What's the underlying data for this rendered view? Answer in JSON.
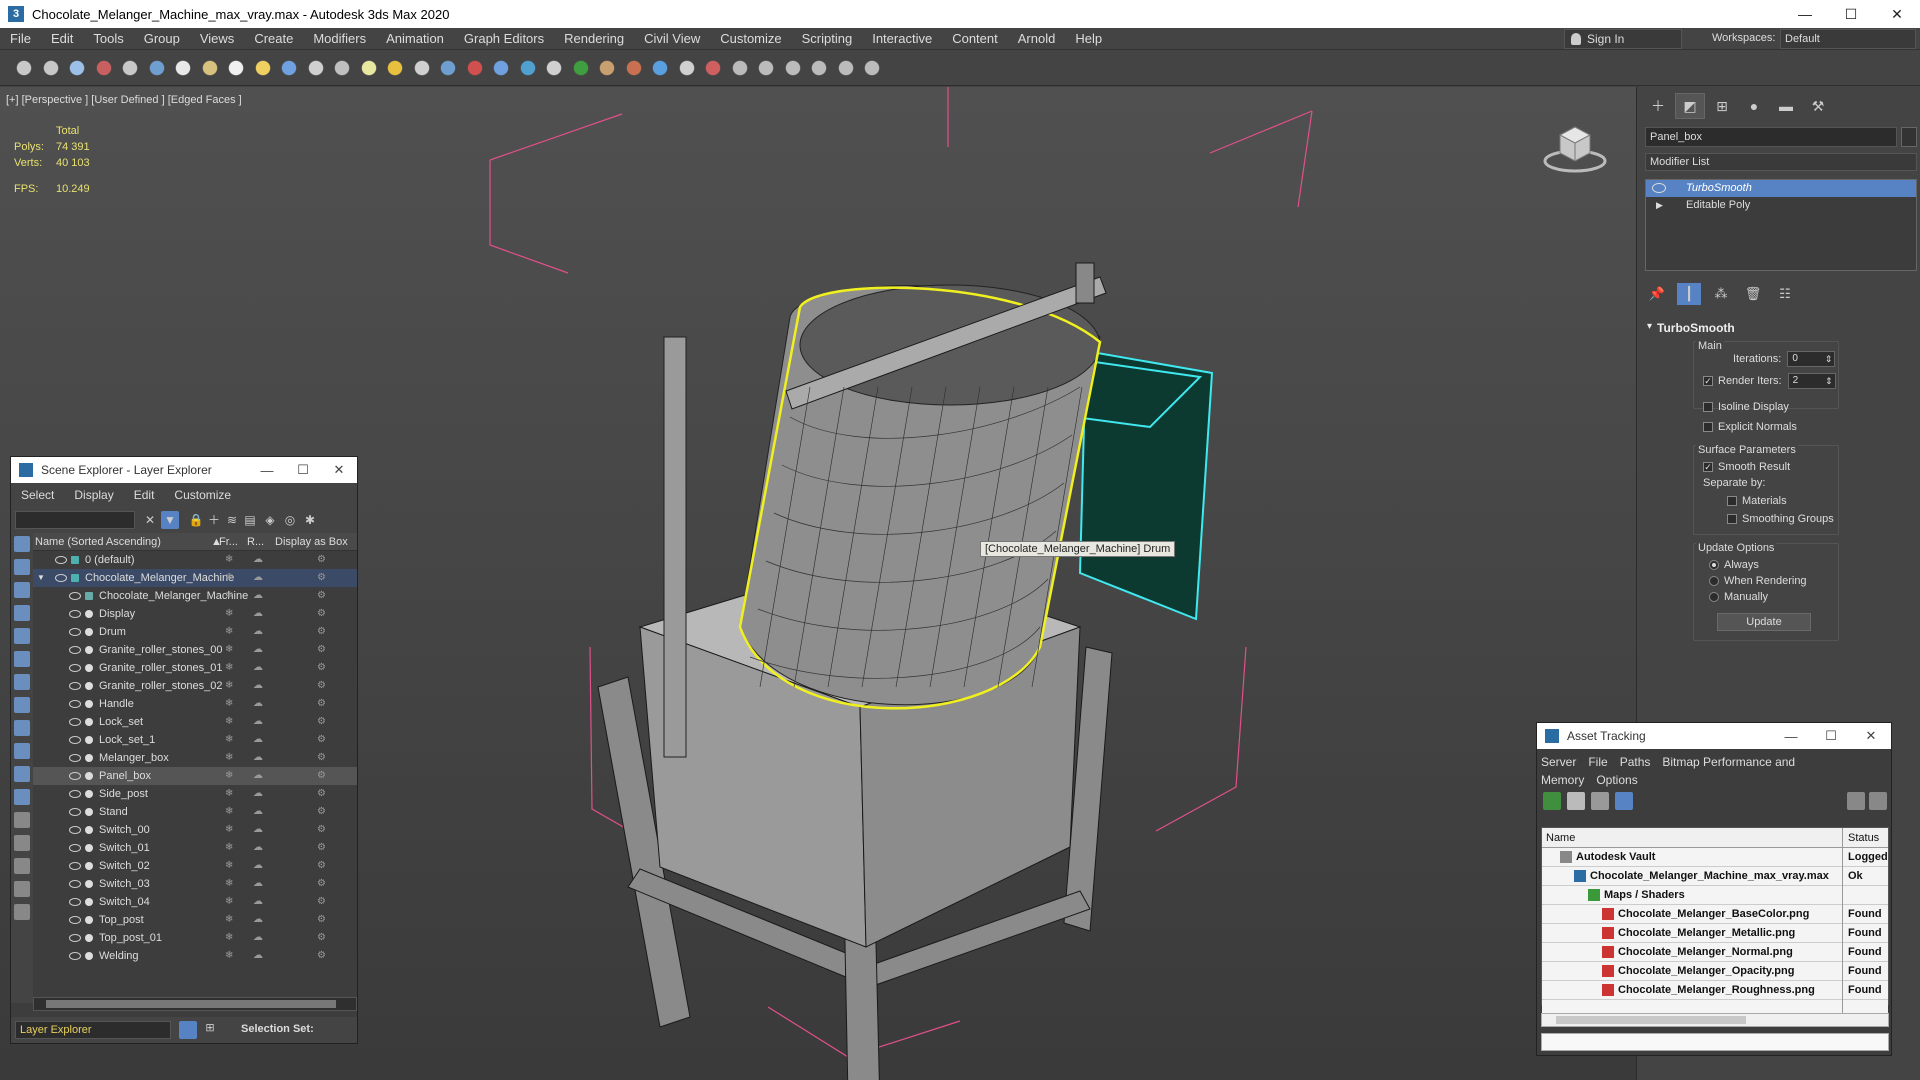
{
  "window": {
    "title": "Chocolate_Melanger_Machine_max_vray.max - Autodesk 3ds Max 2020",
    "minimize": "—",
    "maximize": "☐",
    "close": "✕"
  },
  "menubar": {
    "items": [
      "File",
      "Edit",
      "Tools",
      "Group",
      "Views",
      "Create",
      "Modifiers",
      "Animation",
      "Graph Editors",
      "Rendering",
      "Civil View",
      "Customize",
      "Scripting",
      "Interactive",
      "Content",
      "Arnold",
      "Help"
    ],
    "sign_in": "Sign In",
    "workspaces_label": "Workspaces:",
    "workspace_value": "Default"
  },
  "viewport": {
    "label": "[+] [Perspective ] [User Defined ] [Edged Faces ]",
    "stats": {
      "total_label": "Total",
      "polys_label": "Polys:",
      "polys_value": "74 391",
      "verts_label": "Verts:",
      "verts_value": "40 103",
      "fps_label": "FPS:",
      "fps_value": "10.249"
    },
    "tooltip": "[Chocolate_Melanger_Machine] Drum"
  },
  "command_panel": {
    "object_name": "Panel_box",
    "modifier_list": "Modifier List",
    "stack": [
      {
        "label": "TurboSmooth",
        "selected": true
      },
      {
        "label": "Editable Poly",
        "selected": false
      }
    ],
    "rollout_title": "TurboSmooth",
    "main_label": "Main",
    "iterations_label": "Iterations:",
    "iterations_value": "0",
    "render_iters_label": "Render Iters:",
    "render_iters_value": "2",
    "isoline_label": "Isoline Display",
    "explicit_normals_label": "Explicit Normals",
    "surface_params_label": "Surface Parameters",
    "smooth_result_label": "Smooth Result",
    "separate_by_label": "Separate by:",
    "materials_label": "Materials",
    "smoothing_groups_label": "Smoothing Groups",
    "update_options_label": "Update Options",
    "always_label": "Always",
    "when_rendering_label": "When Rendering",
    "manually_label": "Manually",
    "update_button": "Update"
  },
  "scene_explorer": {
    "title": "Scene Explorer - Layer Explorer",
    "menu": [
      "Select",
      "Display",
      "Edit",
      "Customize"
    ],
    "columns": {
      "name": "Name (Sorted Ascending)",
      "frozen": "Fr...",
      "renderable": "R...",
      "display_as_box": "Display as Box"
    },
    "rows": [
      {
        "name": "0 (default)",
        "level": 0,
        "kind": "layer"
      },
      {
        "name": "Chocolate_Melanger_Machine",
        "level": 0,
        "kind": "layer-open",
        "selected": true
      },
      {
        "name": "Chocolate_Melanger_Machine",
        "level": 1,
        "kind": "group"
      },
      {
        "name": "Display",
        "level": 1,
        "kind": "obj"
      },
      {
        "name": "Drum",
        "level": 1,
        "kind": "obj"
      },
      {
        "name": "Granite_roller_stones_00",
        "level": 1,
        "kind": "obj"
      },
      {
        "name": "Granite_roller_stones_01",
        "level": 1,
        "kind": "obj"
      },
      {
        "name": "Granite_roller_stones_02",
        "level": 1,
        "kind": "obj"
      },
      {
        "name": "Handle",
        "level": 1,
        "kind": "obj"
      },
      {
        "name": "Lock_set",
        "level": 1,
        "kind": "obj"
      },
      {
        "name": "Lock_set_1",
        "level": 1,
        "kind": "obj"
      },
      {
        "name": "Melanger_box",
        "level": 1,
        "kind": "obj"
      },
      {
        "name": "Panel_box",
        "level": 1,
        "kind": "obj",
        "highlight": true
      },
      {
        "name": "Side_post",
        "level": 1,
        "kind": "obj"
      },
      {
        "name": "Stand",
        "level": 1,
        "kind": "obj"
      },
      {
        "name": "Switch_00",
        "level": 1,
        "kind": "obj"
      },
      {
        "name": "Switch_01",
        "level": 1,
        "kind": "obj"
      },
      {
        "name": "Switch_02",
        "level": 1,
        "kind": "obj"
      },
      {
        "name": "Switch_03",
        "level": 1,
        "kind": "obj"
      },
      {
        "name": "Switch_04",
        "level": 1,
        "kind": "obj"
      },
      {
        "name": "Top_post",
        "level": 1,
        "kind": "obj"
      },
      {
        "name": "Top_post_01",
        "level": 1,
        "kind": "obj"
      },
      {
        "name": "Welding",
        "level": 1,
        "kind": "obj"
      }
    ],
    "footer_layer": "Layer Explorer",
    "selection_set_label": "Selection Set:"
  },
  "asset_tracking": {
    "title": "Asset Tracking",
    "menu": [
      "Server",
      "File",
      "Paths",
      "Bitmap Performance and Memory",
      "Options"
    ],
    "columns": {
      "name": "Name",
      "status": "Status"
    },
    "rows": [
      {
        "name": "Autodesk Vault",
        "status": "Logged",
        "indent": 1,
        "icon": "vault"
      },
      {
        "name": "Chocolate_Melanger_Machine_max_vray.max",
        "status": "Ok",
        "indent": 2,
        "icon": "max"
      },
      {
        "name": "Maps / Shaders",
        "status": "",
        "indent": 3,
        "icon": "maps"
      },
      {
        "name": "Chocolate_Melanger_BaseColor.png",
        "status": "Found",
        "indent": 4,
        "icon": "png"
      },
      {
        "name": "Chocolate_Melanger_Metallic.png",
        "status": "Found",
        "indent": 4,
        "icon": "png"
      },
      {
        "name": "Chocolate_Melanger_Normal.png",
        "status": "Found",
        "indent": 4,
        "icon": "png"
      },
      {
        "name": "Chocolate_Melanger_Opacity.png",
        "status": "Found",
        "indent": 4,
        "icon": "png"
      },
      {
        "name": "Chocolate_Melanger_Roughness.png",
        "status": "Found",
        "indent": 4,
        "icon": "png"
      }
    ]
  },
  "colors": {
    "selection_blue": "#5783c4",
    "stats_yellow": "#e8e070",
    "bbox_pink": "#e0508a",
    "selected_yellow": "#f0f020",
    "selected_cyan": "#40e8f0"
  }
}
